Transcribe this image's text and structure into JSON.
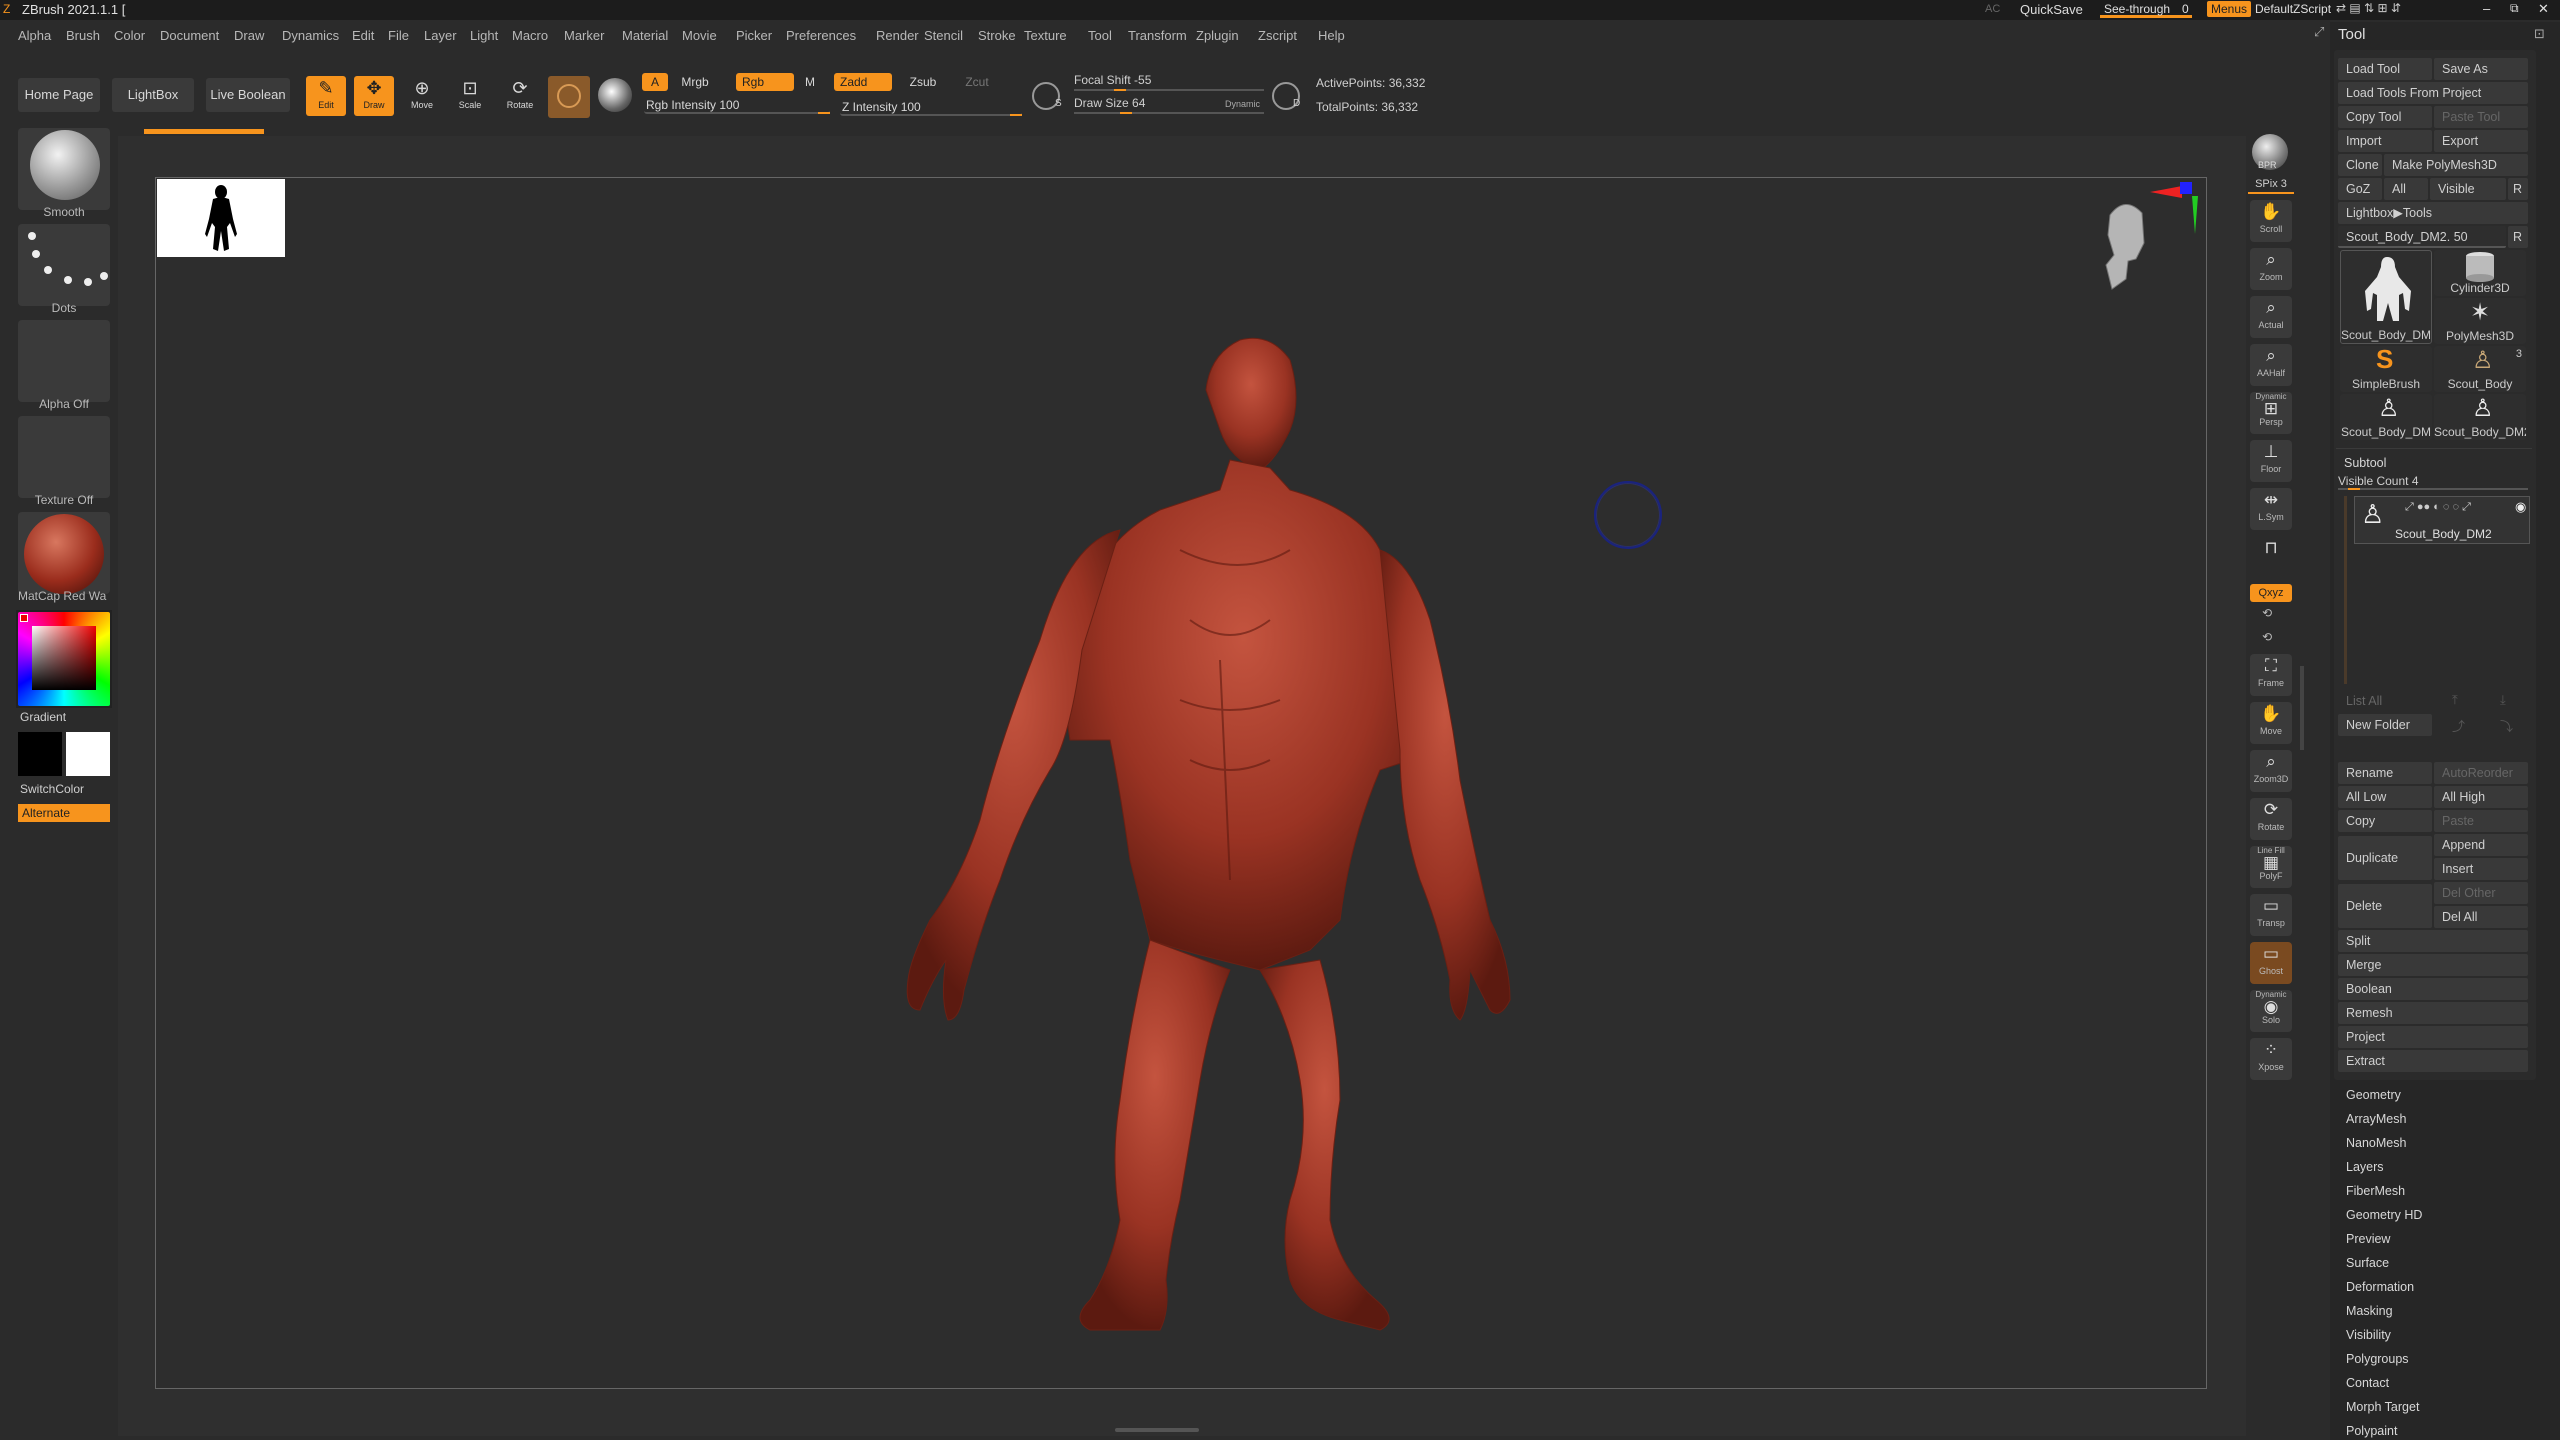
{
  "app": {
    "title": "ZBrush 2021.1.1 [",
    "ac_label": "AC",
    "quicksave": "QuickSave",
    "see_through": "See-through",
    "see_through_value": "0",
    "menus_label": "Menus",
    "zscript_label": "DefaultZScript"
  },
  "menu": [
    "Alpha",
    "Brush",
    "Color",
    "Document",
    "Draw",
    "Dynamics",
    "Edit",
    "File",
    "Layer",
    "Light",
    "Macro",
    "Marker",
    "Material",
    "Movie",
    "Picker",
    "Preferences",
    "Render",
    "Stencil",
    "Stroke",
    "Texture",
    "Tool",
    "Transform",
    "Zplugin",
    "Zscript",
    "Help"
  ],
  "toolbar": {
    "home": "Home Page",
    "lightbox": "LightBox",
    "live_boolean": "Live Boolean",
    "edit": "Edit",
    "draw": "Draw",
    "move": "Move",
    "scale": "Scale",
    "rotate": "Rotate",
    "a": "A",
    "mrgb": "Mrgb",
    "rgb": "Rgb",
    "m": "M",
    "zadd": "Zadd",
    "zsub": "Zsub",
    "zcut": "Zcut",
    "rgb_intensity": "Rgb Intensity 100",
    "z_intensity": "Z Intensity 100",
    "focal_shift": "Focal Shift -55",
    "draw_size": "Draw Size 64",
    "dynamic": "Dynamic",
    "active_points": "ActivePoints: 36,332",
    "total_points": "TotalPoints: 36,332",
    "s_label": "S",
    "d_label": "D"
  },
  "left_shelf": {
    "brush": "Smooth",
    "stroke": "Dots",
    "alpha": "Alpha Off",
    "texture": "Texture Off",
    "material": "MatCap Red Wa",
    "gradient": "Gradient",
    "switch_color": "SwitchColor",
    "alternate": "Alternate"
  },
  "right_shelf": {
    "bpr": "BPR",
    "spix": "SPix 3",
    "scroll": "Scroll",
    "zoom": "Zoom",
    "actual": "Actual",
    "aahalf": "AAHalf",
    "dynamic_persp": "Dynamic",
    "persp": "Persp",
    "floor": "Floor",
    "lsym": "L.Sym",
    "xyz": "Qxyz",
    "frame": "Frame",
    "move": "Move",
    "zoom3d": "Zoom3D",
    "rotate": "Rotate",
    "linefill": "Line Fill",
    "polyf": "PolyF",
    "transp": "Transp",
    "ghost": "Ghost",
    "dynamic_solo": "Dynamic",
    "solo": "Solo",
    "xpose": "Xpose"
  },
  "tool_panel": {
    "title": "Tool",
    "load_tool": "Load Tool",
    "save_as": "Save As",
    "load_from_project": "Load Tools From Project",
    "copy_tool": "Copy Tool",
    "paste_tool": "Paste Tool",
    "import": "Import",
    "export": "Export",
    "clone": "Clone",
    "make_polymesh": "Make PolyMesh3D",
    "goz": "GoZ",
    "all": "All",
    "visible": "Visible",
    "r": "R",
    "lightbox_tools": "Lightbox▶Tools",
    "current_tool": "Scout_Body_DM2. 50",
    "thumbs": [
      "Scout_Body_DM.",
      "Cylinder3D",
      "PolyMesh3D",
      "SimpleBrush",
      "Scout_Body",
      "Scout_Body_DM",
      "Scout_Body_DM2"
    ],
    "scout_count": "3",
    "subtool": "Subtool",
    "visible_count": "Visible Count 4",
    "subtool_name": "Scout_Body_DM2",
    "list_all": "List All",
    "new_folder": "New Folder",
    "rename": "Rename",
    "autoreorder": "AutoReorder",
    "all_low": "All Low",
    "all_high": "All High",
    "copy": "Copy",
    "paste": "Paste",
    "duplicate": "Duplicate",
    "append": "Append",
    "insert": "Insert",
    "delete": "Delete",
    "del_other": "Del Other",
    "del_all": "Del All",
    "split": "Split",
    "merge": "Merge",
    "boolean": "Boolean",
    "remesh": "Remesh",
    "project": "Project",
    "extract": "Extract",
    "sections": [
      "Geometry",
      "ArrayMesh",
      "NanoMesh",
      "Layers",
      "FiberMesh",
      "Geometry HD",
      "Preview",
      "Surface",
      "Deformation",
      "Masking",
      "Visibility",
      "Polygroups",
      "Contact",
      "Morph Target",
      "Polypaint"
    ]
  },
  "colors": {
    "accent": "#f7941d",
    "model": "#a83a2a",
    "background": "#2b2b2b"
  },
  "slider_levels": {
    "rgb_intensity": 100,
    "z_intensity": 100,
    "focal_shift": -55,
    "draw_size": 64
  }
}
